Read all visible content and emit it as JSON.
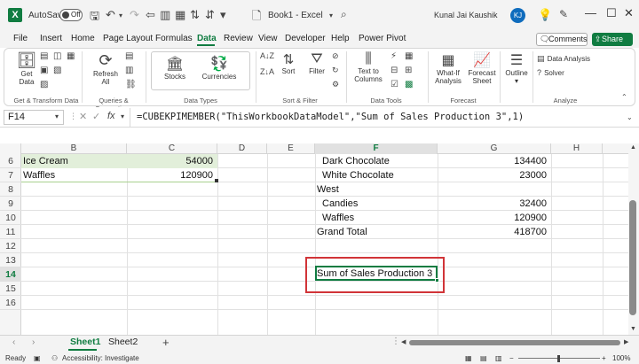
{
  "titlebar": {
    "autosave_label": "AutoSave",
    "autosave_state": "Off",
    "document_title": "Book1 - Excel",
    "user_name": "Kunal Jai Kaushik",
    "user_initials": "KJ"
  },
  "tabs": [
    "File",
    "Insert",
    "Home",
    "Page Layout",
    "Formulas",
    "Data",
    "Review",
    "View",
    "Developer",
    "Help",
    "Power Pivot"
  ],
  "active_tab": "Data",
  "comments_label": "Comments",
  "share_label": "Share",
  "ribbon": {
    "get_data": "Get Data",
    "get_data_line1": "Get",
    "get_data_line2": "Data",
    "refresh_line1": "Refresh",
    "refresh_line2": "All",
    "stocks": "Stocks",
    "currencies": "Currencies",
    "sort": "Sort",
    "filter": "Filter",
    "text_to_columns_1": "Text to",
    "text_to_columns_2": "Columns",
    "whatif_1": "What-If",
    "whatif_2": "Analysis",
    "forecast_1": "Forecast",
    "forecast_2": "Sheet",
    "outline": "Outline",
    "data_analysis": "Data Analysis",
    "solver": "Solver",
    "groups": {
      "get_transform": "Get & Transform Data",
      "queries": "Queries & Connections",
      "data_types": "Data Types",
      "sort_filter": "Sort & Filter",
      "data_tools": "Data Tools",
      "forecast": "Forecast",
      "analyze": "Analyze"
    }
  },
  "formula_bar": {
    "name_box": "F14",
    "fx": "fx",
    "formula": "=CUBEKPIMEMBER(\"ThisWorkbookDataModel\",\"Sum of Sales Production 3\",1)"
  },
  "columns": [
    "B",
    "C",
    "D",
    "E",
    "F",
    "G",
    "H"
  ],
  "rows": [
    "6",
    "7",
    "8",
    "9",
    "10",
    "11",
    "12",
    "13",
    "14",
    "15",
    "16"
  ],
  "cells": {
    "b6": "Ice Cream",
    "c6": "54000",
    "b7": "Waffles",
    "c7": "120900",
    "f6": "Dark Chocolate",
    "g6": "134400",
    "f7": "White Chocolate",
    "g7": "23000",
    "f8": "West",
    "f9": "Candies",
    "g9": "32400",
    "f10": "Waffles",
    "g10": "120900",
    "f11": "Grand Total",
    "g11": "418700",
    "f14": "Sum of Sales Production 3"
  },
  "sheets": [
    "Sheet1",
    "Sheet2"
  ],
  "active_sheet": "Sheet1",
  "status": {
    "ready": "Ready",
    "accessibility": "Accessibility: Investigate",
    "zoom": "100%"
  },
  "colors": {
    "accent": "#107c41",
    "highlight": "#d13438",
    "table_fill": "#e2efda"
  }
}
